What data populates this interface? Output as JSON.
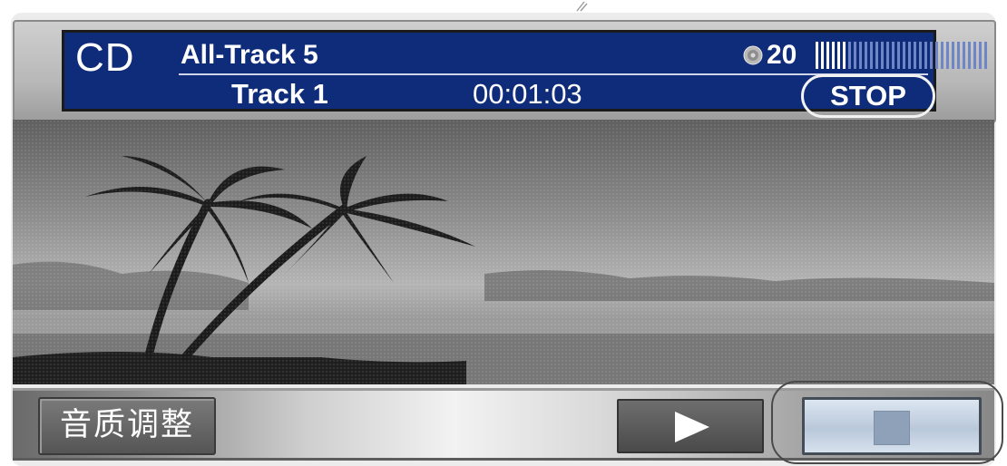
{
  "header": {
    "source_label": "CD",
    "mode_label": "All-Track 5",
    "track_label": "Track 1",
    "elapsed_time": "00:01:03",
    "volume_value": "20",
    "volume_level_fraction": 0.2,
    "volume_segments_total": 32,
    "play_status": "STOP",
    "disc_icon": "disc-icon"
  },
  "scene": {
    "description_icon": "palm-beach-sunset-image"
  },
  "controls": {
    "sound_adjust_label": "音质调整",
    "play_icon": "play-icon",
    "stop_icon": "stop-icon"
  },
  "colors": {
    "display_bg": "#0f2c7a",
    "display_text": "#ffffff",
    "volume_active": "#ffffff",
    "volume_inactive": "#6f86c6",
    "stop_button_face": "#c6d3e3"
  }
}
